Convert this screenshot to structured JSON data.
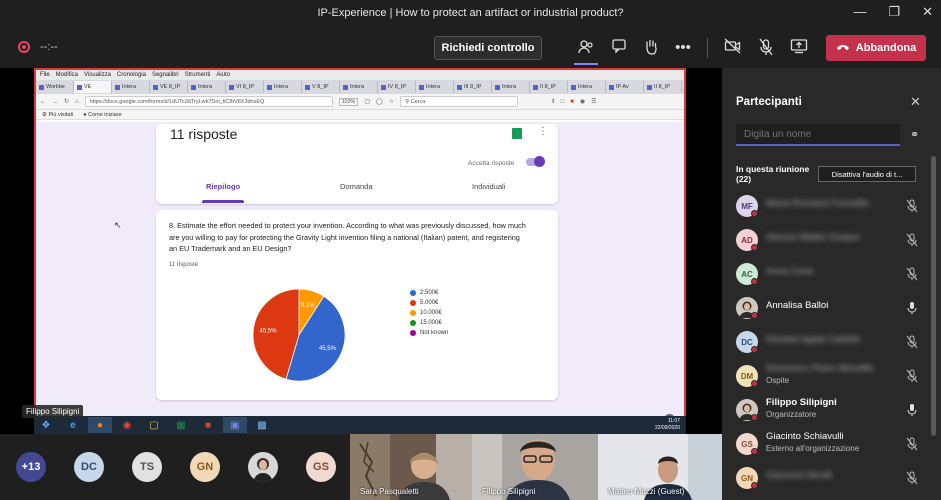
{
  "window": {
    "title": "IP-Experience | How to protect an artifact or industrial product?"
  },
  "toolbar": {
    "timer": "--:--",
    "request_control": "Richiedi controllo",
    "leave": "Abbandona",
    "icons": [
      "participants-icon",
      "chat-icon",
      "raise-hand-icon",
      "more-icon",
      "camera-off-icon",
      "mic-off-icon",
      "share-icon"
    ]
  },
  "browser": {
    "menu": [
      "File",
      "Modifica",
      "Visualizza",
      "Cronologia",
      "Segnalibri",
      "Strumenti",
      "Aiuto"
    ],
    "tabs": [
      "Workbe",
      "VE",
      "Intera",
      "VE 8_IP",
      "Intera",
      "VI 8_IP",
      "Intera",
      "V 8_IP",
      "Intera",
      "IV 8_IP",
      "Intera",
      "III 8_IP",
      "Intera",
      "II 8_IP",
      "Intera",
      "IP Av",
      "II 8_IP"
    ],
    "url": "https://docs.google.com/forms/d/1dUTc3dTryLwk7Dol_tlC8tV8X3dnsEQ",
    "zoom": "110%",
    "search_placeholder": "Cerca",
    "bookmarks": [
      "Più visitati",
      "Come iniziare"
    ]
  },
  "form": {
    "responses_title": "11 risposte",
    "accept_label": "Accetta risposte",
    "tabs": [
      "Riepilogo",
      "Domanda",
      "Individuali"
    ],
    "question": "8. Estimate the effort needed to protect your invention. According to what was previously discussed, how much are you willing to pay for protecting the Gravity Light invention filing a national (Italian) patent, and registering an EU Trademark and an EU Design?",
    "count": "11 risposte",
    "help": "?"
  },
  "chart_data": {
    "type": "pie",
    "categories": [
      "2.500€",
      "5.000€",
      "10.000€",
      "15.000€",
      "Not known"
    ],
    "values": [
      45.5,
      45.5,
      9.1,
      0,
      0
    ],
    "data_labels": [
      "45,5%",
      "45,5%",
      "9,1%",
      "",
      ""
    ],
    "colors": [
      "#3366cc",
      "#dc3912",
      "#ff9900",
      "#109618",
      "#990099"
    ],
    "legend": "right"
  },
  "taskbar": {
    "time": "11:07",
    "date": "22/09/2020",
    "apps": [
      "start",
      "ie",
      "firefox",
      "chrome",
      "explorer",
      "excel",
      "powerpoint",
      "teams",
      "photos"
    ]
  },
  "presenter": {
    "name": "Filippo Silipigni"
  },
  "gallery": {
    "overflow": "+13",
    "avatars": [
      {
        "initials": "DC",
        "bg": "#c7d7ea",
        "fg": "#2b4b72"
      },
      {
        "initials": "TS",
        "bg": "#e1e1e1",
        "fg": "#555"
      },
      {
        "initials": "GN",
        "bg": "#f1d9b8",
        "fg": "#8a5a1c"
      },
      {
        "initials": "",
        "bg": "#cfcfcf",
        "fg": "#555"
      },
      {
        "initials": "GS",
        "bg": "#f1d9cf",
        "fg": "#7a4a3a"
      }
    ],
    "videos": [
      "Sara Pasqualetti",
      "Filippo Silipigni",
      "Matteo Mozzi (Guest)"
    ]
  },
  "panel": {
    "title": "Partecipanti",
    "search_placeholder": "Digita un nome",
    "in_meeting": "In questa riunione (22)",
    "mute_all": "Disattiva l'audio di t...",
    "participants": [
      {
        "initials": "MF",
        "name": "Maria Romana Fumolillo",
        "role": "",
        "blur": true,
        "bg": "#dcd6ec",
        "fg": "#4a3c7a",
        "status": "#c4314b"
      },
      {
        "initials": "AD",
        "name": "Alessio Walter Dodaro",
        "role": "",
        "blur": true,
        "bg": "#f3d1d4",
        "fg": "#8a2a34",
        "status": "#c4314b"
      },
      {
        "initials": "AC",
        "name": "Anna Conti",
        "role": "",
        "blur": true,
        "bg": "#cfe8d8",
        "fg": "#2d6a44",
        "status": "#c4314b"
      },
      {
        "initials": "",
        "name": "Annalisa Balloi",
        "role": "",
        "blur": false,
        "bg": "#7a6a60",
        "fg": "#fff",
        "status": "#c4314b"
      },
      {
        "initials": "DC",
        "name": "Daniela Agata Cabella",
        "role": "",
        "blur": true,
        "bg": "#c7d7ea",
        "fg": "#2b4b72",
        "status": "#c4314b"
      },
      {
        "initials": "DM",
        "name": "Domenico Pietro Minutillo",
        "role": "Ospite",
        "blur": true,
        "bg": "#f1e3b8",
        "fg": "#7a6218",
        "status": "#c4314b"
      },
      {
        "initials": "",
        "name": "Filippo Silipigni",
        "role": "Organizzatore",
        "blur": false,
        "bg": "#5a4a40",
        "fg": "#fff",
        "status": "#c4314b"
      },
      {
        "initials": "GS",
        "name": "Giacinto Schiavulli",
        "role": "Esterno all'organizzazione",
        "blur": false,
        "bg": "#f1d9cf",
        "fg": "#7a4a3a",
        "status": "#c4314b"
      },
      {
        "initials": "GN",
        "name": "Giacomo Nicolli",
        "role": "",
        "blur": true,
        "bg": "#f1d9b8",
        "fg": "#8a5a1c",
        "status": "#c4314b"
      }
    ]
  }
}
